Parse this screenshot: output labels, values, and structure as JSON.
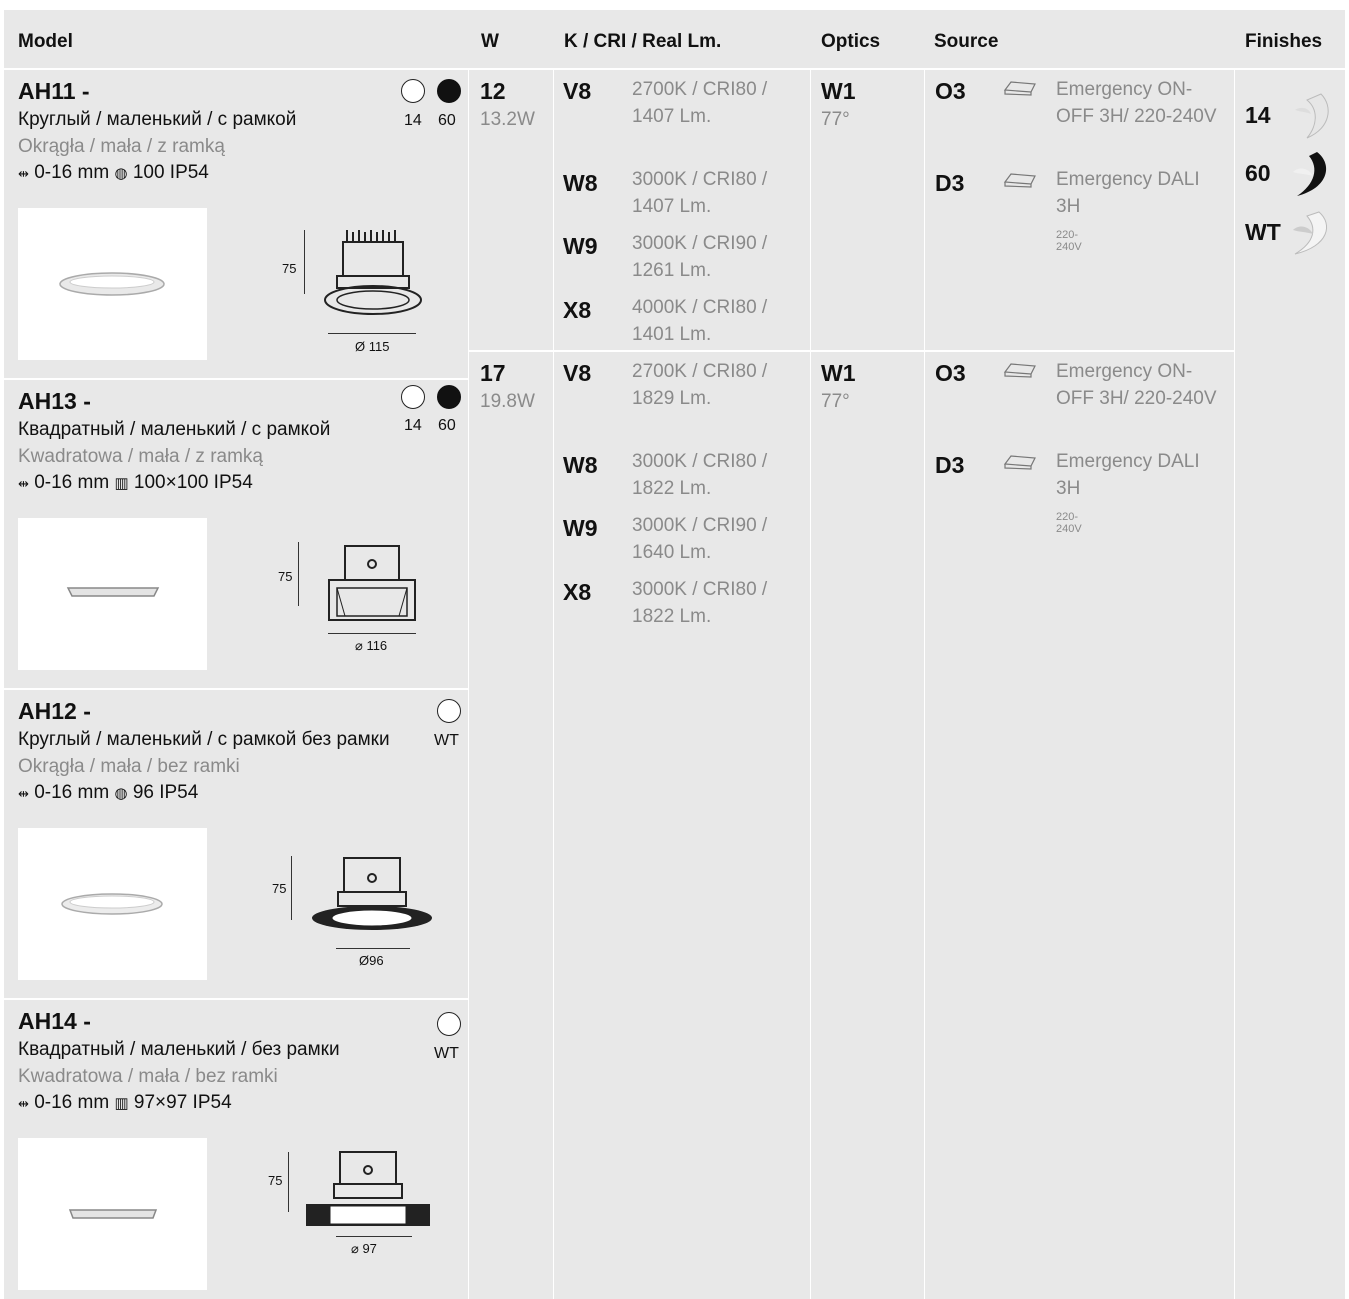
{
  "header": {
    "model": "Model",
    "w": "W",
    "kcri": "K / CRI / Real Lm.",
    "optics": "Optics",
    "source": "Source",
    "finishes": "Finishes"
  },
  "models": [
    {
      "title": "AH11 -",
      "ru": "Круглый / маленький / с рамкой",
      "pl": "Okrągła / mała / z ramką",
      "spec_mount": "0-16 mm",
      "spec_cut": "100 IP54",
      "finish_codes": [
        "14",
        "60"
      ],
      "dim_height": "75",
      "dim_width": "Ø 115"
    },
    {
      "title": "AH13 -",
      "ru": "Квадратный / маленький / с рамкой",
      "pl": "Kwadratowa / mała / z ramką",
      "spec_mount": "0-16 mm",
      "spec_cut": "100×100 IP54",
      "finish_codes": [
        "14",
        "60"
      ],
      "dim_height": "75",
      "dim_width": "⌀ 116"
    },
    {
      "title": "AH12 -",
      "ru": "Круглый / маленький / с рамкой без рамки",
      "pl": "Okrągła / mała / bez ramki",
      "spec_mount": "0-16 mm",
      "spec_cut": "96 IP54",
      "finish_codes": [
        "WT"
      ],
      "dim_height": "75",
      "dim_width": "Ø96"
    },
    {
      "title": "AH14 -",
      "ru": "Квадратный / маленький / без рамки",
      "pl": "Kwadratowa / mała / bez ramki",
      "spec_mount": "0-16 mm",
      "spec_cut": "97×97 IP54",
      "finish_codes": [
        "WT"
      ],
      "dim_height": "75",
      "dim_width": "⌀ 97"
    }
  ],
  "groups": [
    {
      "w": "12",
      "w_real": "13.2W",
      "variants": [
        {
          "code": "V8",
          "text": "2700K / CRI80 / 1407 Lm."
        },
        {
          "code": "W8",
          "text": "3000K / CRI80 / 1407 Lm."
        },
        {
          "code": "W9",
          "text": "3000K / CRI90 / 1261 Lm."
        },
        {
          "code": "X8",
          "text": "4000K / CRI80 / 1401 Lm."
        }
      ],
      "optics_code": "W1",
      "optics_angle": "77°",
      "sources": [
        {
          "code": "O3",
          "text": "Emergency ON-OFF 3H/ 220-240V",
          "note": ""
        },
        {
          "code": "D3",
          "text": "Emergency DALI 3H",
          "note": "220-240V"
        }
      ]
    },
    {
      "w": "17",
      "w_real": "19.8W",
      "variants": [
        {
          "code": "V8",
          "text": "2700K / CRI80 / 1829 Lm."
        },
        {
          "code": "W8",
          "text": "3000K / CRI80 / 1822 Lm."
        },
        {
          "code": "W9",
          "text": "3000K / CRI90 / 1640 Lm."
        },
        {
          "code": "X8",
          "text": "3000K / CRI80 / 1822 Lm."
        }
      ],
      "optics_code": "W1",
      "optics_angle": "77°",
      "sources": [
        {
          "code": "O3",
          "text": "Emergency ON-OFF 3H/ 220-240V",
          "note": ""
        },
        {
          "code": "D3",
          "text": "Emergency DALI 3H",
          "note": "220-240V"
        }
      ]
    }
  ],
  "finishes": [
    {
      "code": "14",
      "swatch_color": "#f2f2f2"
    },
    {
      "code": "60",
      "swatch_color": "#111111"
    },
    {
      "code": "WT",
      "swatch_color": "#ffffff"
    }
  ],
  "colors": {
    "background": "#e8e8e8",
    "text": "#111111",
    "muted": "#8a8a8a"
  }
}
